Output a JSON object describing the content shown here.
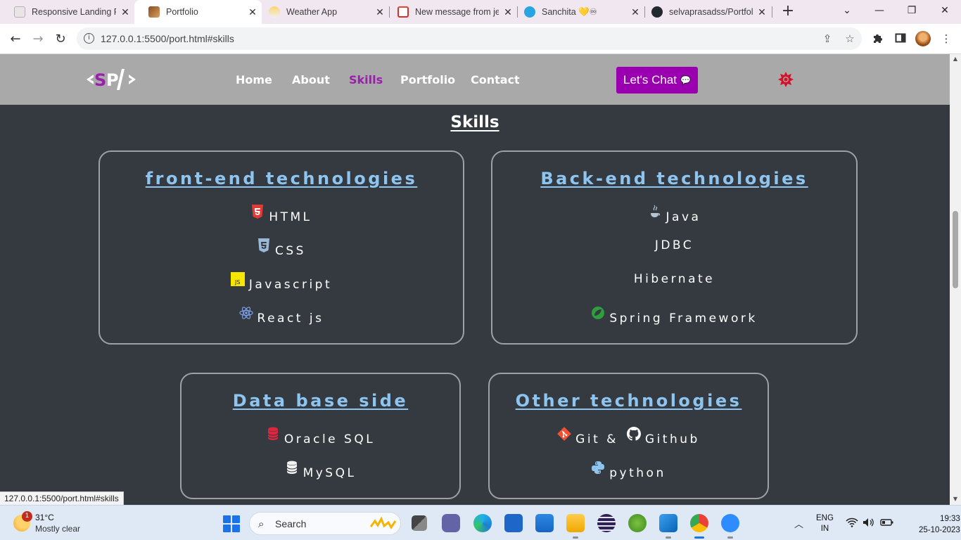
{
  "browser": {
    "tabs": [
      {
        "title": "Responsive Landing P",
        "active": false
      },
      {
        "title": "Portfolio",
        "active": true
      },
      {
        "title": "Weather App",
        "active": false
      },
      {
        "title": "New message from je",
        "active": false
      },
      {
        "title": "Sanchita 💛♾",
        "active": false
      },
      {
        "title": "selvaprasadss/Portfol",
        "active": false
      }
    ],
    "url": "127.0.0.1:5500/port.html#skills",
    "status_url": "127.0.0.1:5500/port.html#skills"
  },
  "site": {
    "logo_text": "<SP/>",
    "nav": [
      {
        "label": "Home",
        "active": false
      },
      {
        "label": "About",
        "active": false
      },
      {
        "label": "Skills",
        "active": true
      },
      {
        "label": "Portfolio",
        "active": false
      },
      {
        "label": "Contact",
        "active": false
      }
    ],
    "chat_button": "Let's Chat",
    "colors": {
      "header_bg": "#a9a9a9",
      "page_bg": "#343a40",
      "accent": "#9b00b0",
      "card_title": "#8ec5f0"
    }
  },
  "skills": {
    "title": "Skills",
    "cards": [
      {
        "title": "front-end technologies",
        "items": [
          {
            "label": "HTML",
            "icon": "html5-icon"
          },
          {
            "label": "CSS",
            "icon": "css3-icon"
          },
          {
            "label": "Javascript",
            "icon": "js-icon"
          },
          {
            "label": "React js",
            "icon": "react-icon"
          }
        ]
      },
      {
        "title": "Back-end technologies",
        "items": [
          {
            "label": "Java",
            "icon": "java-icon"
          },
          {
            "label": "JDBC",
            "icon": ""
          },
          {
            "label": "Hibernate",
            "icon": ""
          },
          {
            "label": "Spring Framework",
            "icon": "spring-icon"
          }
        ]
      },
      {
        "title": "Data base side",
        "items": [
          {
            "label": "Oracle SQL",
            "icon": "database-icon"
          },
          {
            "label": "MySQL",
            "icon": "database-icon"
          }
        ]
      },
      {
        "title": "Other technologies",
        "items": [
          {
            "label": "Git &",
            "icon": "git-icon"
          },
          {
            "label": "Github",
            "icon": "github-icon"
          },
          {
            "label": "python",
            "icon": "python-icon"
          }
        ]
      }
    ]
  },
  "taskbar": {
    "weather_temp": "31°C",
    "weather_desc": "Mostly clear",
    "weather_badge": "1",
    "search_label": "Search",
    "lang_top": "ENG",
    "lang_bottom": "IN",
    "time": "19:33",
    "date": "25-10-2023"
  }
}
